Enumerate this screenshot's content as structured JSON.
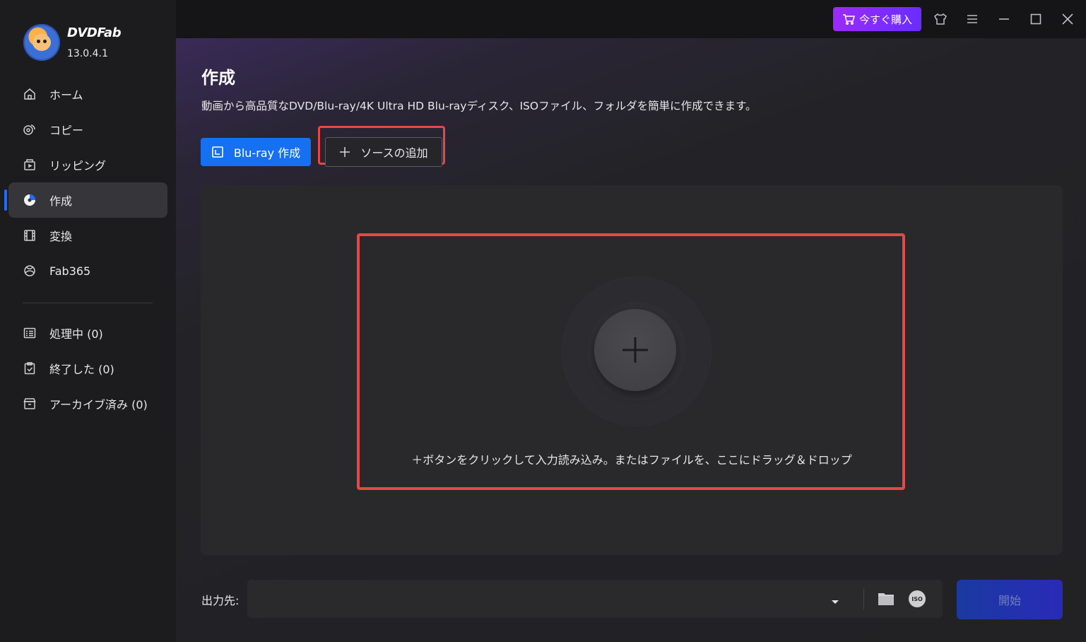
{
  "app": {
    "brand": "DVDFab",
    "version": "13.0.4.1"
  },
  "sidebar": {
    "items": [
      {
        "label": "ホーム",
        "icon": "home-icon"
      },
      {
        "label": "コピー",
        "icon": "copy-icon"
      },
      {
        "label": "リッピング",
        "icon": "ripping-icon"
      },
      {
        "label": "作成",
        "icon": "create-disc-icon",
        "active": true
      },
      {
        "label": "変換",
        "icon": "convert-icon"
      },
      {
        "label": "Fab365",
        "icon": "fab365-icon"
      }
    ],
    "queue": [
      {
        "label": "処理中 (0)",
        "icon": "processing-icon"
      },
      {
        "label": "終了した (0)",
        "icon": "finished-icon"
      },
      {
        "label": "アーカイブ済み (0)",
        "icon": "archive-icon"
      }
    ]
  },
  "titlebar": {
    "buy_label": "今すぐ購入",
    "icons": [
      "skin-icon",
      "menu-icon",
      "minimize-icon",
      "maximize-icon",
      "close-icon"
    ]
  },
  "main": {
    "title": "作成",
    "description": "動画から高品質なDVD/Blu-ray/4K Ultra HD Blu-rayディスク、ISOファイル、フォルダを簡単に作成できます。",
    "mode_button": "Blu-ray 作成",
    "add_source": "ソースの追加",
    "drop_hint": "＋ボタンをクリックして入力読み込み。またはファイルを、ここにドラッグ＆ドロップ"
  },
  "output": {
    "label": "出力先:",
    "value": "",
    "start_label": "開始"
  },
  "colors": {
    "accent": "#1671f2",
    "buy": "#8a2bff",
    "highlight": "#e84747",
    "sidebar_bg": "#1c1c1f"
  }
}
